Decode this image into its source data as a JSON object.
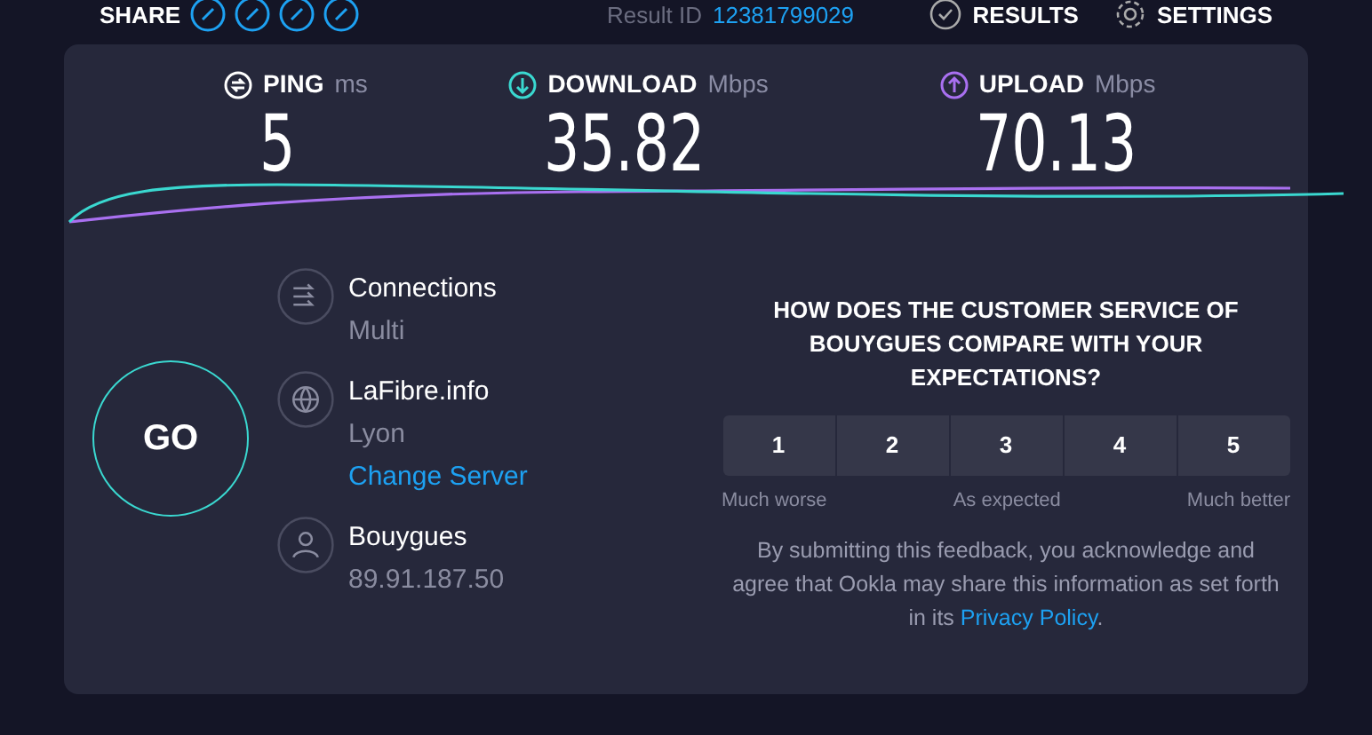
{
  "top_bar": {
    "share_label": "SHARE",
    "result_id_label": "Result ID",
    "result_id": "12381799029",
    "results": "RESULTS",
    "settings": "SETTINGS"
  },
  "metrics": [
    {
      "kind": "ping",
      "label": "PING",
      "unit": "ms",
      "value": "5",
      "color": "#ffffff"
    },
    {
      "kind": "download",
      "label": "DOWNLOAD",
      "unit": "Mbps",
      "value": "35.82",
      "color": "#3ad8d0"
    },
    {
      "kind": "upload",
      "label": "UPLOAD",
      "unit": "Mbps",
      "value": "70.13",
      "color": "#a970f0"
    }
  ],
  "go_button": "GO",
  "connection": {
    "kind": "connections",
    "title": "Connections",
    "value": "Multi"
  },
  "server": {
    "kind": "server",
    "title": "LaFibre.info",
    "value": "Lyon",
    "link": "Change Server"
  },
  "provider": {
    "kind": "provider",
    "title": "Bouygues",
    "value": "89.91.187.50"
  },
  "survey": {
    "question": "HOW DOES THE CUSTOMER SERVICE OF BOUYGUES COMPARE WITH YOUR EXPECTATIONS?",
    "options": [
      {
        "label": "1",
        "selected": false
      },
      {
        "label": "2",
        "selected": false
      },
      {
        "label": "3",
        "selected": false
      },
      {
        "label": "4",
        "selected": false
      },
      {
        "label": "5",
        "selected": false
      }
    ],
    "scale_labels": [
      "Much worse",
      "As expected",
      "Much better"
    ],
    "disclaimer": "By submitting this feedback, you acknowledge and agree that Ookla may share this information as set forth in its",
    "link": "Privacy Policy",
    "end": "."
  }
}
